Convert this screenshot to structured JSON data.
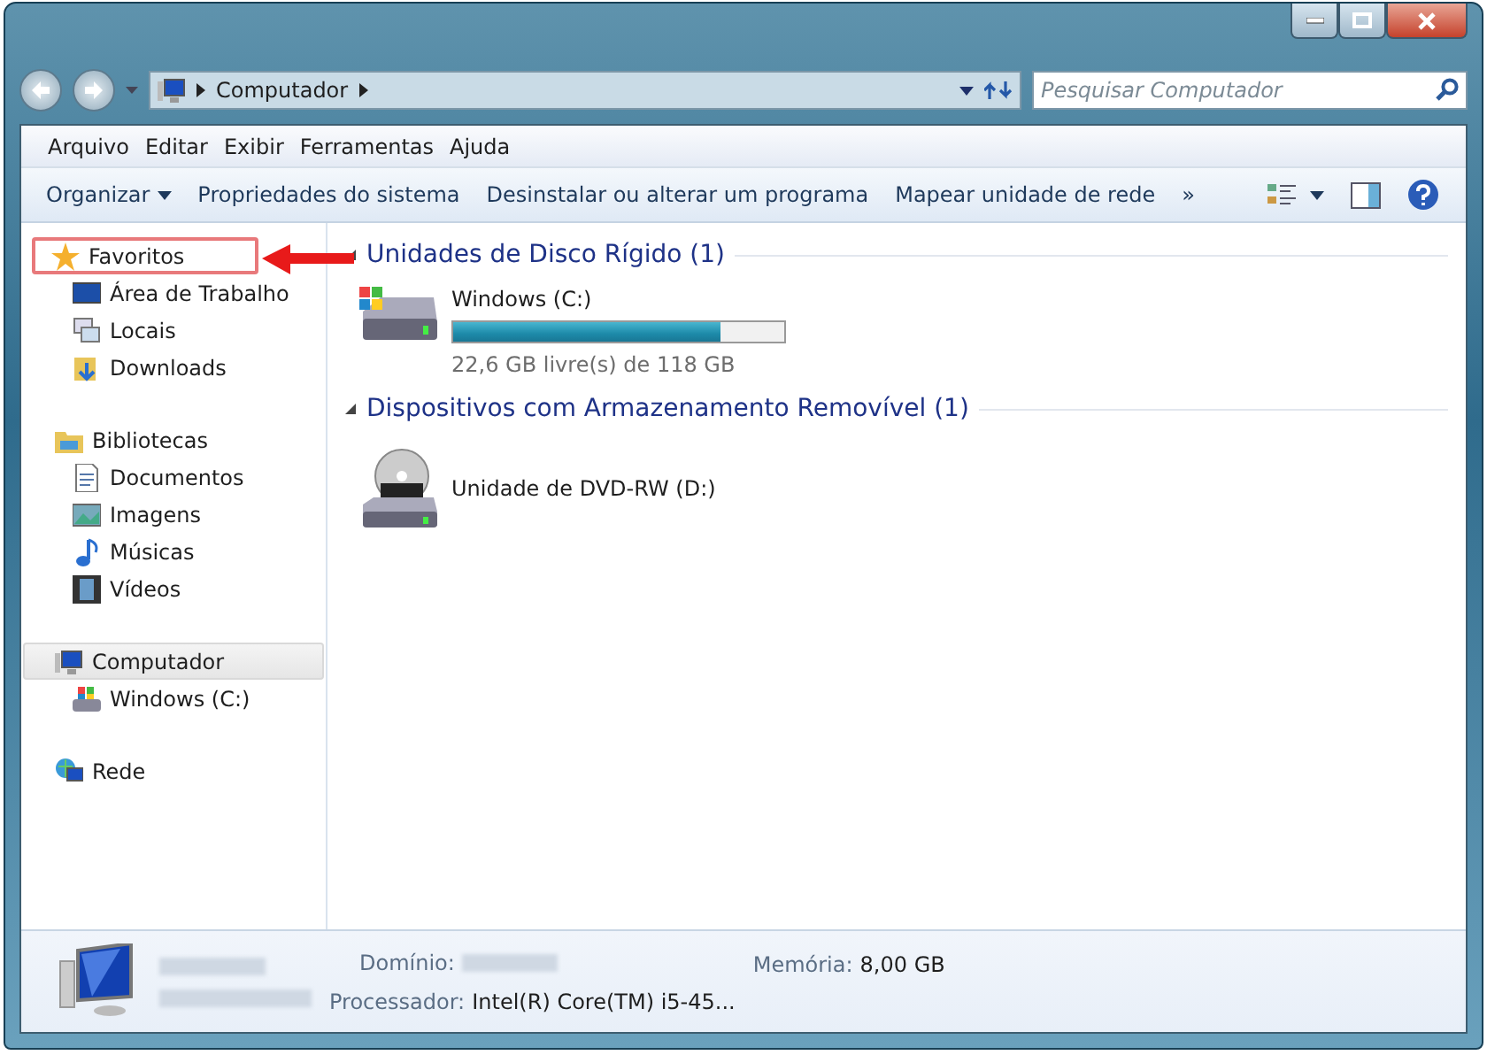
{
  "address": {
    "crumbs": [
      "Computador"
    ]
  },
  "search": {
    "placeholder": "Pesquisar Computador"
  },
  "menu": [
    "Arquivo",
    "Editar",
    "Exibir",
    "Ferramentas",
    "Ajuda"
  ],
  "commands": [
    {
      "label": "Organizar",
      "dropdown": true
    },
    {
      "label": "Propriedades do sistema",
      "dropdown": false
    },
    {
      "label": "Desinstalar ou alterar um programa",
      "dropdown": false
    },
    {
      "label": "Mapear unidade de rede",
      "dropdown": false
    }
  ],
  "more": "»",
  "sidebar": {
    "items": [
      {
        "label": "Favoritos",
        "selected": false,
        "highlighted": true,
        "children": [
          {
            "label": "Área de Trabalho",
            "selected": false
          },
          {
            "label": "Locais",
            "selected": false
          },
          {
            "label": "Downloads",
            "selected": false
          }
        ]
      },
      {
        "label": "Bibliotecas",
        "selected": false,
        "highlighted": false,
        "children": [
          {
            "label": "Documentos",
            "selected": false
          },
          {
            "label": "Imagens",
            "selected": false
          },
          {
            "label": "Músicas",
            "selected": false
          },
          {
            "label": "Vídeos",
            "selected": false
          }
        ]
      },
      {
        "label": "Computador",
        "selected": true,
        "highlighted": false,
        "children": [
          {
            "label": "Windows (C:)",
            "selected": false
          }
        ]
      },
      {
        "label": "Rede",
        "selected": false,
        "highlighted": false
      }
    ]
  },
  "groups": [
    {
      "title": "Unidades de Disco Rígido (1)",
      "drives": [
        {
          "kind": "hdd",
          "name": "Windows (C:)",
          "level": 0.81,
          "free": "22,6 GB livre(s) de 118 GB"
        }
      ]
    },
    {
      "title": "Dispositivos com Armazenamento Removível (1)",
      "drives": [
        {
          "kind": "dvd",
          "name": "Unidade de DVD-RW (D:)"
        }
      ]
    }
  ],
  "details": {
    "fields": [
      {
        "label": "Domínio:"
      },
      {
        "label": "Processador:",
        "value": "Intel(R) Core(TM) i5-45..."
      },
      {
        "label": "Memória:",
        "value": "8,00 GB"
      }
    ]
  }
}
